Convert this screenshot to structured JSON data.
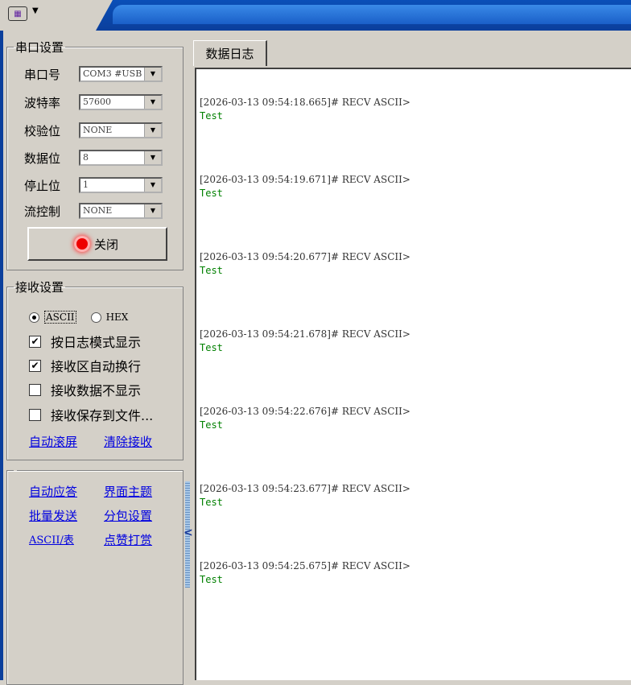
{
  "serial_settings": {
    "title": "串口设置",
    "port_label": "串口号",
    "port_value": "COM3 #USB",
    "baud_label": "波特率",
    "baud_value": "57600",
    "parity_label": "校验位",
    "parity_value": "NONE",
    "databits_label": "数据位",
    "databits_value": "8",
    "stopbits_label": "停止位",
    "stopbits_value": "1",
    "flow_label": "流控制",
    "flow_value": "NONE",
    "close_button": "关闭"
  },
  "receive_settings": {
    "title": "接收设置",
    "mode_ascii": "ASCII",
    "mode_hex": "HEX",
    "options": [
      {
        "label": "按日志模式显示",
        "checked": "✔"
      },
      {
        "label": "接收区自动换行",
        "checked": "✔"
      },
      {
        "label": "接收数据不显示",
        "checked": ""
      },
      {
        "label": "接收保存到文件...",
        "checked": ""
      }
    ],
    "auto_scroll": "自动滚屏",
    "clear_recv": "清除接收"
  },
  "tools": {
    "auto_reply": "自动应答",
    "theme": "界面主题",
    "batch_send": "批量发送",
    "packet_settings": "分包设置",
    "ascii_table": "ASCII/表",
    "donate": "点赞打赏"
  },
  "log": {
    "tab_label": "数据日志",
    "entries": [
      {
        "header": "[2026-03-13 09:54:18.665]# RECV ASCII>",
        "body": "Test"
      },
      {
        "header": "[2026-03-13 09:54:19.671]# RECV ASCII>",
        "body": "Test"
      },
      {
        "header": "[2026-03-13 09:54:20.677]# RECV ASCII>",
        "body": "Test"
      },
      {
        "header": "[2026-03-13 09:54:21.678]# RECV ASCII>",
        "body": "Test"
      },
      {
        "header": "[2026-03-13 09:54:22.676]# RECV ASCII>",
        "body": "Test"
      },
      {
        "header": "[2026-03-13 09:54:23.677]# RECV ASCII>",
        "body": "Test"
      },
      {
        "header": "[2026-03-13 09:54:25.675]# RECV ASCII>",
        "body": "Test"
      }
    ]
  },
  "colors": {
    "title_bar": "#0b3f9c",
    "log_body": "#008000",
    "link": "#0000e0",
    "led": "#e00000"
  }
}
